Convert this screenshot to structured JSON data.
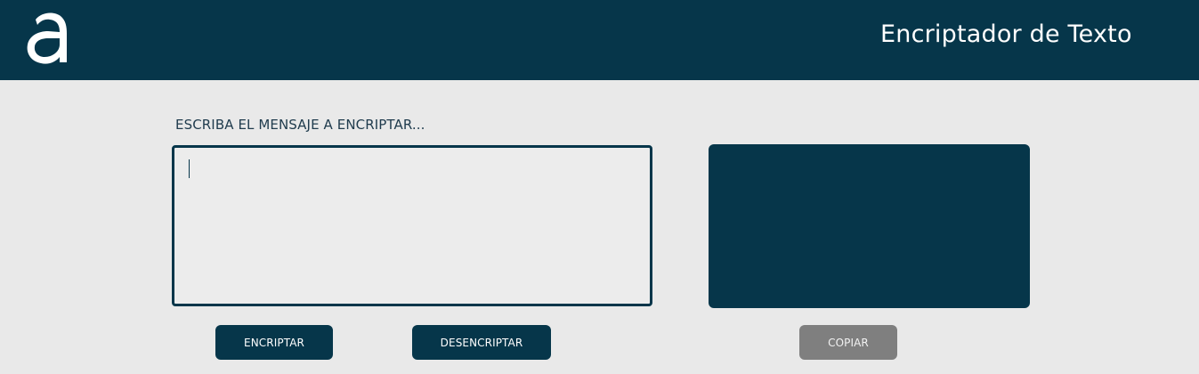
{
  "header": {
    "logo_icon": "letter-a-logo",
    "title": "Encriptador de Texto"
  },
  "main": {
    "prompt_label": "ESCRIBA EL MENSAJE A ENCRIPTAR...",
    "input": {
      "value": "",
      "placeholder": ""
    },
    "output": {
      "value": ""
    },
    "buttons": {
      "encrypt_label": "ENCRIPTAR",
      "decrypt_label": "DESENCRIPTAR",
      "copy_label": "COPIAR"
    }
  },
  "colors": {
    "primary": "#06364a",
    "background": "#e9e9e9",
    "disabled": "#7f7f7f"
  }
}
